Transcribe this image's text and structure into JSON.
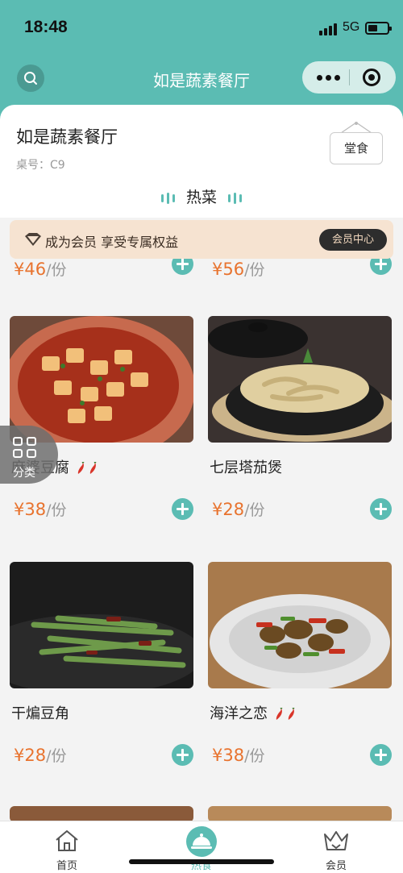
{
  "status_bar": {
    "time": "18:48",
    "network": "5G"
  },
  "nav": {
    "title": "如是蔬素餐厅"
  },
  "restaurant": {
    "name": "如是蔬素餐厅",
    "table": "桌号：C9",
    "dine_mode": "堂食"
  },
  "category_tab": "热菜",
  "member_banner": {
    "text": "成为会员 享受专属权益",
    "button": "会员中心"
  },
  "floating": {
    "label": "分类"
  },
  "dishes_partial": [
    {
      "price": "¥46",
      "unit": "/份"
    },
    {
      "price": "¥56",
      "unit": "/份"
    }
  ],
  "dishes": [
    {
      "name": "麻婆豆腐",
      "spicy": true,
      "price": "¥38",
      "unit": "/份"
    },
    {
      "name": "七层塔茄煲",
      "spicy": false,
      "price": "¥28",
      "unit": "/份"
    },
    {
      "name": "干煸豆角",
      "spicy": false,
      "price": "¥28",
      "unit": "/份"
    },
    {
      "name": "海洋之恋",
      "spicy": true,
      "price": "¥38",
      "unit": "/份"
    }
  ],
  "tabbar": [
    {
      "label": "首页",
      "icon": "home-icon"
    },
    {
      "label": "热食",
      "icon": "cloche-icon"
    },
    {
      "label": "会员",
      "icon": "crown-icon"
    }
  ],
  "colors": {
    "accent": "#5bbcb3",
    "price": "#e8732e",
    "banner": "#f6e3d1"
  }
}
